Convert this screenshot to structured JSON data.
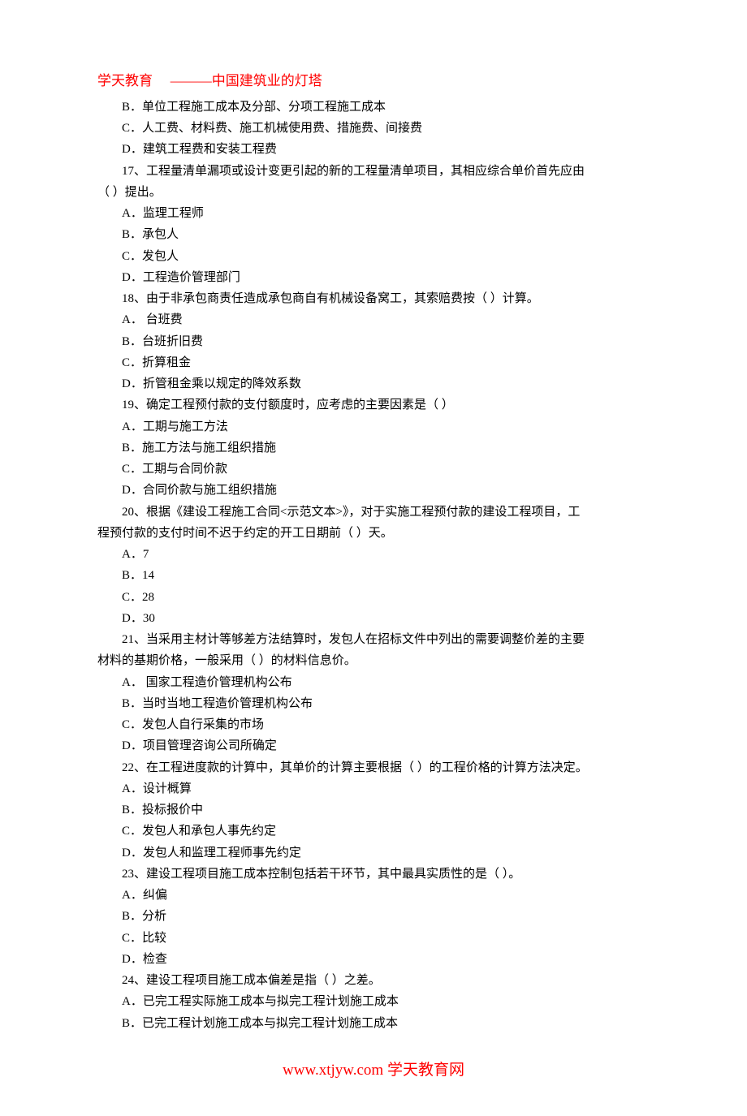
{
  "header": {
    "brand": "学天教育",
    "slogan": "———中国建筑业的灯塔"
  },
  "lines": {
    "opt_B_pre": "B．单位工程施工成本及分部、分项工程施工成本",
    "opt_C_pre": "C．人工费、材料费、施工机械使用费、措施费、间接费",
    "opt_D_pre": "D．建筑工程费和安装工程费",
    "q17": "17、工程量清单漏项或设计变更引起的新的工程量清单项目，其相应综合单价首先应由",
    "q17_cont": "（ ）提出。",
    "q17_A": "A．监理工程师",
    "q17_B": "B．承包人",
    "q17_C": "C．发包人",
    "q17_D": "D．工程造价管理部门",
    "q18": "18、由于非承包商责任造成承包商自有机械设备窝工，其索赔费按（ ）计算。",
    "q18_A": "A． 台班费",
    "q18_B": "B．台班折旧费",
    "q18_C": "C．折算租金",
    "q18_D": "D．折管租金乘以规定的降效系数",
    "q19": "19、确定工程预付款的支付额度时，应考虑的主要因素是（ ）",
    "q19_A": "A．工期与施工方法",
    "q19_B": "B．施工方法与施工组织措施",
    "q19_C": "C．工期与合同价款",
    "q19_D": "D．合同价款与施工组织措施",
    "q20": "20、根据《建设工程施工合同<示范文本>》，对于实施工程预付款的建设工程项目，工",
    "q20_cont": "程预付款的支付时间不迟于约定的开工日期前（ ）天。",
    "q20_A": "A．7",
    "q20_B": "B．14",
    "q20_C": "C．28",
    "q20_D": "D．30",
    "q21": "21、当采用主材计等够差方法结算时，发包人在招标文件中列出的需要调整价差的主要",
    "q21_cont": "材料的基期价格，一般采用（ ）的材料信息价。",
    "q21_A": "A． 国家工程造价管理机构公布",
    "q21_B": "B．当时当地工程造价管理机构公布",
    "q21_C": "C．发包人自行采集的市场",
    "q21_D": "D．项目管理咨询公司所确定",
    "q22": "22、在工程进度款的计算中，其单价的计算主要根据（ ）的工程价格的计算方法决定。",
    "q22_A": "A．设计概算",
    "q22_B": "B．投标报价中",
    "q22_C": "C．发包人和承包人事先约定",
    "q22_D": "D．发包人和监理工程师事先约定",
    "q23": "23、建设工程项目施工成本控制包括若干环节，其中最具实质性的是（ ）。",
    "q23_A": "A．纠偏",
    "q23_B": "B．分析",
    "q23_C": "C．比较",
    "q23_D": "D．检查",
    "q24": "24、建设工程项目施工成本偏差是指（ ）之差。",
    "q24_A": "A．已完工程实际施工成本与拟完工程计划施工成本",
    "q24_B": "B．已完工程计划施工成本与拟完工程计划施工成本"
  },
  "footer": {
    "url": "www.xtjyw.com",
    "site": " 学天教育网"
  }
}
